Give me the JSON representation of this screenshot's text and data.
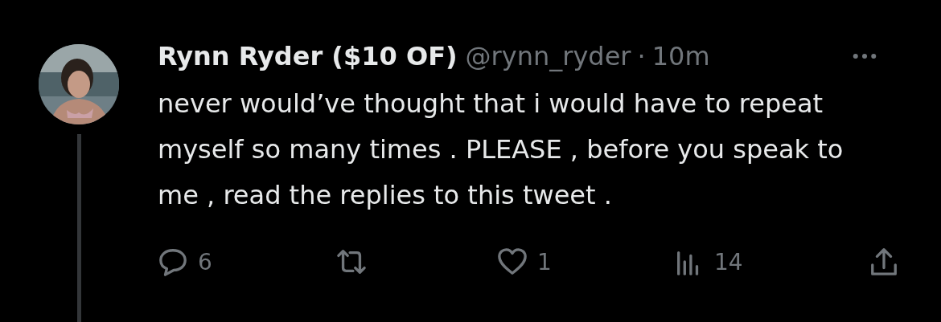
{
  "author": {
    "name": "Rynn Ryder ($10 OF)",
    "handle": "@rynn_ryder",
    "separator": "·",
    "time": "10m"
  },
  "text": "never would’ve thought that i would have to repeat myself so many times . PLEASE , before you speak to me , read the replies to this tweet .",
  "actions": [
    {
      "kind": "reply",
      "count": "6"
    },
    {
      "kind": "retweet"
    },
    {
      "kind": "like",
      "count": "1"
    },
    {
      "kind": "views",
      "count": "14"
    },
    {
      "kind": "share"
    }
  ]
}
